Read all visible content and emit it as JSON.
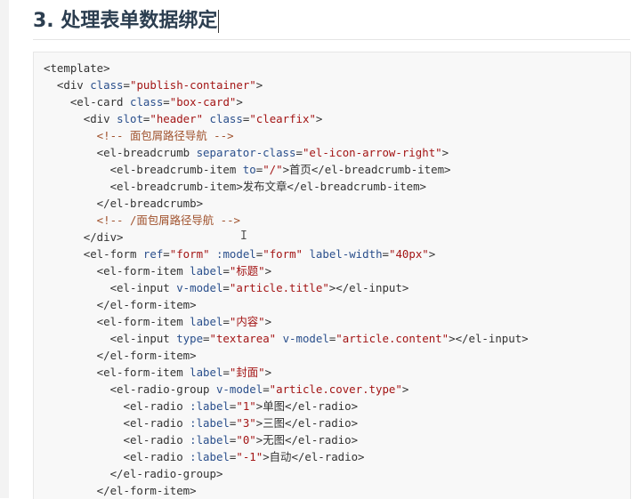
{
  "section": {
    "heading": "3. 处理表单数据绑定"
  },
  "code": {
    "lines": [
      [
        {
          "t": "tag",
          "v": "<template>"
        }
      ],
      [
        {
          "t": "tag",
          "v": "  <div "
        },
        {
          "t": "attr",
          "v": "class"
        },
        {
          "t": "tag",
          "v": "="
        },
        {
          "t": "str",
          "v": "\"publish-container\""
        },
        {
          "t": "tag",
          "v": ">"
        }
      ],
      [
        {
          "t": "tag",
          "v": "    <el-card "
        },
        {
          "t": "attr",
          "v": "class"
        },
        {
          "t": "tag",
          "v": "="
        },
        {
          "t": "str",
          "v": "\"box-card\""
        },
        {
          "t": "tag",
          "v": ">"
        }
      ],
      [
        {
          "t": "tag",
          "v": "      <div "
        },
        {
          "t": "attr",
          "v": "slot"
        },
        {
          "t": "tag",
          "v": "="
        },
        {
          "t": "str",
          "v": "\"header\""
        },
        {
          "t": "tag",
          "v": " "
        },
        {
          "t": "attr",
          "v": "class"
        },
        {
          "t": "tag",
          "v": "="
        },
        {
          "t": "str",
          "v": "\"clearfix\""
        },
        {
          "t": "tag",
          "v": ">"
        }
      ],
      [
        {
          "t": "comment",
          "v": "        <!-- 面包屑路径导航 -->"
        }
      ],
      [
        {
          "t": "tag",
          "v": "        <el-breadcrumb "
        },
        {
          "t": "attr",
          "v": "separator-class"
        },
        {
          "t": "tag",
          "v": "="
        },
        {
          "t": "str",
          "v": "\"el-icon-arrow-right\""
        },
        {
          "t": "tag",
          "v": ">"
        }
      ],
      [
        {
          "t": "tag",
          "v": "          <el-breadcrumb-item "
        },
        {
          "t": "attr",
          "v": "to"
        },
        {
          "t": "tag",
          "v": "="
        },
        {
          "t": "str",
          "v": "\"/\""
        },
        {
          "t": "tag",
          "v": ">"
        },
        {
          "t": "txt",
          "v": "首页"
        },
        {
          "t": "tag",
          "v": "</el-breadcrumb-item>"
        }
      ],
      [
        {
          "t": "tag",
          "v": "          <el-breadcrumb-item>"
        },
        {
          "t": "txt",
          "v": "发布文章"
        },
        {
          "t": "tag",
          "v": "</el-breadcrumb-item>"
        }
      ],
      [
        {
          "t": "tag",
          "v": "        </el-breadcrumb>"
        }
      ],
      [
        {
          "t": "comment",
          "v": "        <!-- /面包屑路径导航 -->"
        }
      ],
      [
        {
          "t": "tag",
          "v": "      </div>"
        }
      ],
      [
        {
          "t": "tag",
          "v": "      <el-form "
        },
        {
          "t": "attr",
          "v": "ref"
        },
        {
          "t": "tag",
          "v": "="
        },
        {
          "t": "str",
          "v": "\"form\""
        },
        {
          "t": "tag",
          "v": " "
        },
        {
          "t": "attr",
          "v": ":model"
        },
        {
          "t": "tag",
          "v": "="
        },
        {
          "t": "str",
          "v": "\"form\""
        },
        {
          "t": "tag",
          "v": " "
        },
        {
          "t": "attr",
          "v": "label-width"
        },
        {
          "t": "tag",
          "v": "="
        },
        {
          "t": "str",
          "v": "\"40px\""
        },
        {
          "t": "tag",
          "v": ">"
        }
      ],
      [
        {
          "t": "tag",
          "v": "        <el-form-item "
        },
        {
          "t": "attr",
          "v": "label"
        },
        {
          "t": "tag",
          "v": "="
        },
        {
          "t": "str",
          "v": "\"标题\""
        },
        {
          "t": "tag",
          "v": ">"
        }
      ],
      [
        {
          "t": "tag",
          "v": "          <el-input "
        },
        {
          "t": "attr",
          "v": "v-model"
        },
        {
          "t": "tag",
          "v": "="
        },
        {
          "t": "str",
          "v": "\"article.title\""
        },
        {
          "t": "tag",
          "v": "></el-input>"
        }
      ],
      [
        {
          "t": "tag",
          "v": "        </el-form-item>"
        }
      ],
      [
        {
          "t": "tag",
          "v": "        <el-form-item "
        },
        {
          "t": "attr",
          "v": "label"
        },
        {
          "t": "tag",
          "v": "="
        },
        {
          "t": "str",
          "v": "\"内容\""
        },
        {
          "t": "tag",
          "v": ">"
        }
      ],
      [
        {
          "t": "tag",
          "v": "          <el-input "
        },
        {
          "t": "attr",
          "v": "type"
        },
        {
          "t": "tag",
          "v": "="
        },
        {
          "t": "str",
          "v": "\"textarea\""
        },
        {
          "t": "tag",
          "v": " "
        },
        {
          "t": "attr",
          "v": "v-model"
        },
        {
          "t": "tag",
          "v": "="
        },
        {
          "t": "str",
          "v": "\"article.content\""
        },
        {
          "t": "tag",
          "v": "></el-input>"
        }
      ],
      [
        {
          "t": "tag",
          "v": "        </el-form-item>"
        }
      ],
      [
        {
          "t": "tag",
          "v": "        <el-form-item "
        },
        {
          "t": "attr",
          "v": "label"
        },
        {
          "t": "tag",
          "v": "="
        },
        {
          "t": "str",
          "v": "\"封面\""
        },
        {
          "t": "tag",
          "v": ">"
        }
      ],
      [
        {
          "t": "tag",
          "v": "          <el-radio-group "
        },
        {
          "t": "attr",
          "v": "v-model"
        },
        {
          "t": "tag",
          "v": "="
        },
        {
          "t": "str",
          "v": "\"article.cover.type\""
        },
        {
          "t": "tag",
          "v": ">"
        }
      ],
      [
        {
          "t": "tag",
          "v": "            <el-radio "
        },
        {
          "t": "attr",
          "v": ":label"
        },
        {
          "t": "tag",
          "v": "="
        },
        {
          "t": "str",
          "v": "\"1\""
        },
        {
          "t": "tag",
          "v": ">"
        },
        {
          "t": "txt",
          "v": "单图"
        },
        {
          "t": "tag",
          "v": "</el-radio>"
        }
      ],
      [
        {
          "t": "tag",
          "v": "            <el-radio "
        },
        {
          "t": "attr",
          "v": ":label"
        },
        {
          "t": "tag",
          "v": "="
        },
        {
          "t": "str",
          "v": "\"3\""
        },
        {
          "t": "tag",
          "v": ">"
        },
        {
          "t": "txt",
          "v": "三图"
        },
        {
          "t": "tag",
          "v": "</el-radio>"
        }
      ],
      [
        {
          "t": "tag",
          "v": "            <el-radio "
        },
        {
          "t": "attr",
          "v": ":label"
        },
        {
          "t": "tag",
          "v": "="
        },
        {
          "t": "str",
          "v": "\"0\""
        },
        {
          "t": "tag",
          "v": ">"
        },
        {
          "t": "txt",
          "v": "无图"
        },
        {
          "t": "tag",
          "v": "</el-radio>"
        }
      ],
      [
        {
          "t": "tag",
          "v": "            <el-radio "
        },
        {
          "t": "attr",
          "v": ":label"
        },
        {
          "t": "tag",
          "v": "="
        },
        {
          "t": "str",
          "v": "\"-1\""
        },
        {
          "t": "tag",
          "v": ">"
        },
        {
          "t": "txt",
          "v": "自动"
        },
        {
          "t": "tag",
          "v": "</el-radio>"
        }
      ],
      [
        {
          "t": "tag",
          "v": "          </el-radio-group>"
        }
      ],
      [
        {
          "t": "tag",
          "v": "        </el-form-item>"
        }
      ]
    ]
  },
  "colors": {
    "tag": "#333333",
    "attr": "#2a4f8c",
    "string": "#a31515",
    "comment": "#a0522d",
    "code_bg": "#f8f8f8"
  },
  "icons": {
    "text_cursor": "text-cursor-icon"
  }
}
